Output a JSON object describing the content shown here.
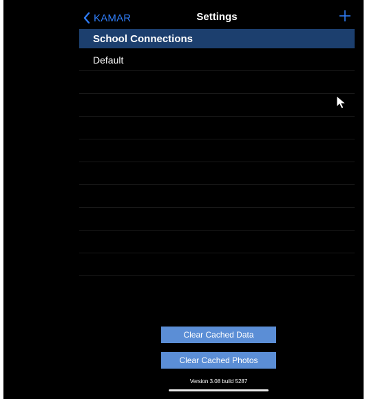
{
  "nav": {
    "back_label": "KAMAR",
    "title": "Settings",
    "add_icon": "plus-icon",
    "back_icon": "chevron-left-icon"
  },
  "section": {
    "title": "School Connections"
  },
  "connections": [
    {
      "label": "Default"
    },
    {
      "label": ""
    },
    {
      "label": ""
    },
    {
      "label": ""
    },
    {
      "label": ""
    },
    {
      "label": ""
    },
    {
      "label": ""
    },
    {
      "label": ""
    },
    {
      "label": ""
    },
    {
      "label": ""
    }
  ],
  "actions": {
    "clear_data_label": "Clear Cached Data",
    "clear_photos_label": "Clear Cached Photos"
  },
  "footer": {
    "version": "Version 3.08 build 5287"
  },
  "colors": {
    "accent": "#2f7cf6",
    "section_bg": "#1c3f6e",
    "button_bg": "#5b8ed6",
    "background": "#000000"
  }
}
